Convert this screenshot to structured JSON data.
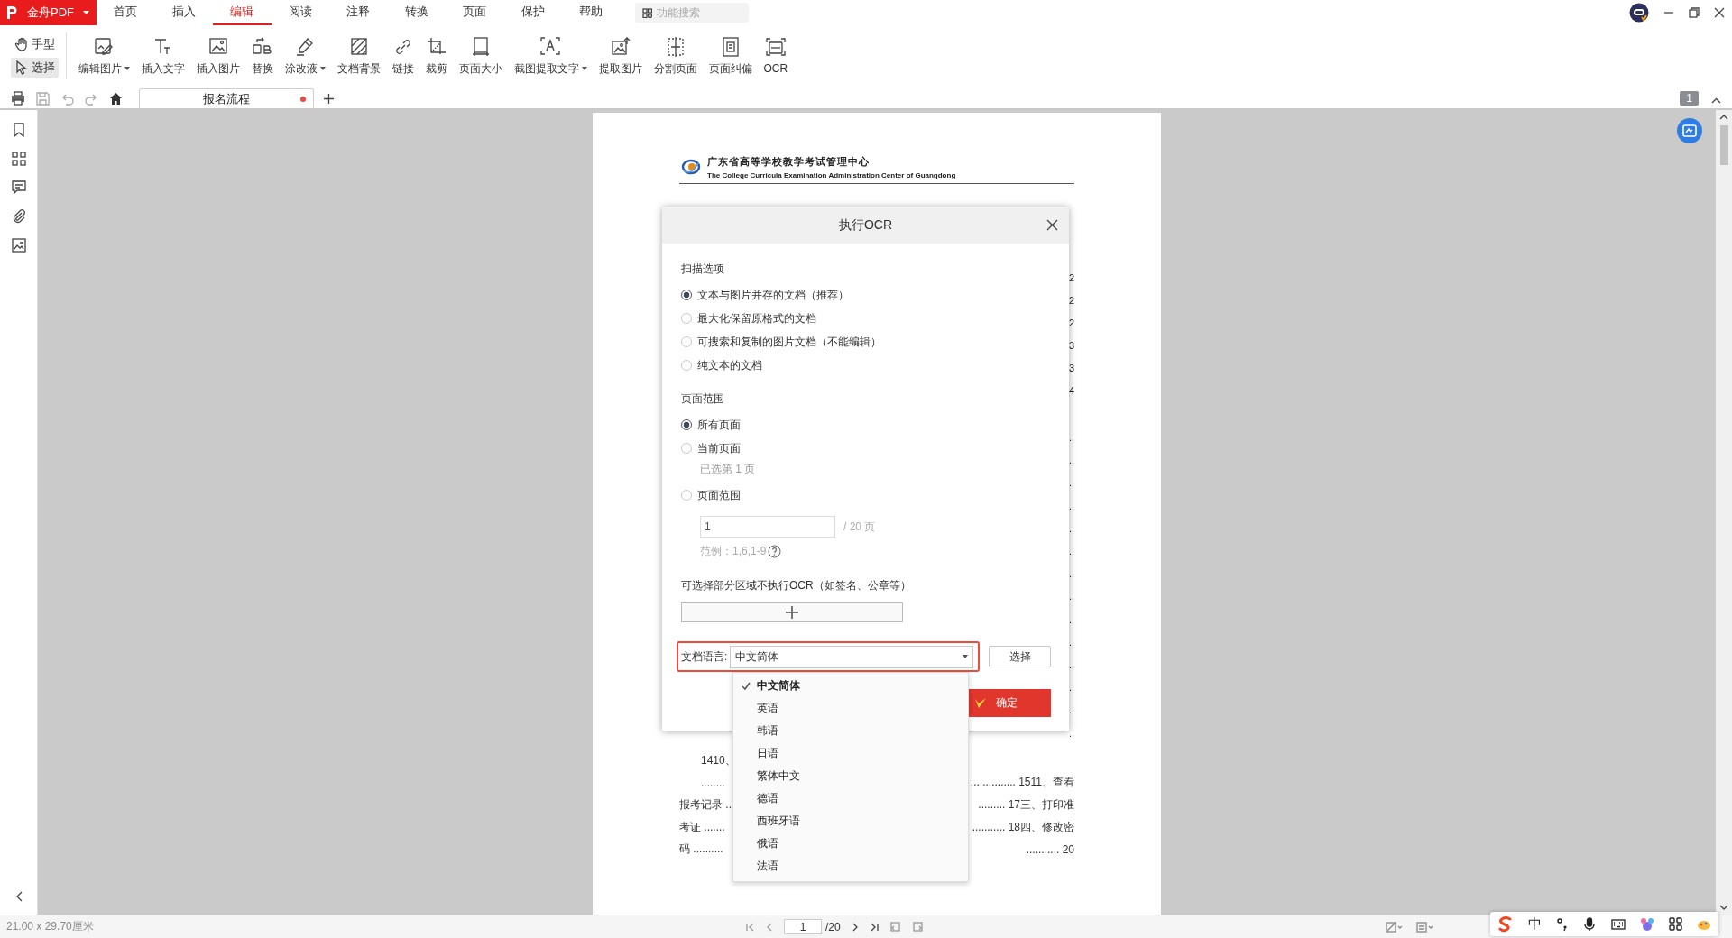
{
  "app": {
    "name": "金舟PDF"
  },
  "menu": [
    {
      "label": "首页",
      "selected": false
    },
    {
      "label": "插入",
      "selected": false
    },
    {
      "label": "编辑",
      "selected": true
    },
    {
      "label": "阅读",
      "selected": false
    },
    {
      "label": "注释",
      "selected": false
    },
    {
      "label": "转换",
      "selected": false
    },
    {
      "label": "页面",
      "selected": false
    },
    {
      "label": "保护",
      "selected": false
    },
    {
      "label": "帮助",
      "selected": false
    }
  ],
  "search": {
    "placeholder": "功能搜索"
  },
  "modes": [
    {
      "label": "手型",
      "kind": "hand",
      "selected": false
    },
    {
      "label": "选择",
      "kind": "select",
      "selected": true
    }
  ],
  "tools": [
    {
      "label": "编辑图片",
      "kind": "edit-image",
      "has_menu": true
    },
    {
      "label": "插入文字",
      "kind": "text",
      "has_menu": false
    },
    {
      "label": "插入图片",
      "kind": "image",
      "has_menu": false
    },
    {
      "label": "替换",
      "kind": "replace",
      "has_menu": false
    },
    {
      "label": "涂改液",
      "kind": "eraser",
      "has_menu": true
    },
    {
      "label": "文档背景",
      "kind": "background",
      "has_menu": false
    },
    {
      "label": "链接",
      "kind": "link",
      "has_menu": false
    },
    {
      "label": "裁剪",
      "kind": "crop",
      "has_menu": false
    },
    {
      "label": "页面大小",
      "kind": "page-size",
      "has_menu": false
    },
    {
      "label": "截图提取文字",
      "kind": "capture-text",
      "has_menu": true
    },
    {
      "label": "提取图片",
      "kind": "extract-image",
      "has_menu": false
    },
    {
      "label": "分割页面",
      "kind": "split",
      "has_menu": false
    },
    {
      "label": "页面纠偏",
      "kind": "deskew",
      "has_menu": false
    },
    {
      "label": "OCR",
      "kind": "ocr",
      "has_menu": false
    }
  ],
  "tabs": [
    {
      "label": "报名流程",
      "selected": true,
      "unsaved": true
    }
  ],
  "page_badge": "1",
  "document": {
    "header_title": "广东省高等学校教学考试管理中心",
    "header_subtitle": "The College Curricula Examination Administration Center of Guangdong",
    "edge_numbers": [
      "2",
      "2",
      "2",
      "3",
      "3",
      "4"
    ],
    "edge_dots": [
      "..",
      "..",
      "..",
      "..",
      "..",
      "..",
      "..",
      "..",
      "..",
      "..",
      "..",
      "..",
      "..",
      ".."
    ],
    "toc_rows": [
      {
        "left": "1410、",
        "indented": true
      },
      {
        "left": "........",
        "right": "............... 1511、查看",
        "indented": true
      },
      {
        "left": "报考记录 ..",
        "right": "......... 17三、打印准",
        "indented": false
      },
      {
        "left": "考证 .......",
        "right": "........... 18四、修改密",
        "indented": false
      },
      {
        "left": "码 ..........",
        "right": "........... 20",
        "indented": false
      }
    ]
  },
  "ocr_dialog": {
    "title": "执行OCR",
    "scan_label": "扫描选项",
    "scan_options": [
      {
        "label": "文本与图片并存的文档（推荐）",
        "selected": true
      },
      {
        "label": "最大化保留原格式的文档",
        "selected": false
      },
      {
        "label": "可搜索和复制的图片文档（不能编辑）",
        "selected": false
      },
      {
        "label": "纯文本的文档",
        "selected": false
      }
    ],
    "range_label": "页面范围",
    "range_options": [
      {
        "label": "所有页面",
        "selected": true
      },
      {
        "label": "当前页面",
        "selected": false,
        "note": "已选第 1 页"
      },
      {
        "label": "页面范围",
        "selected": false
      }
    ],
    "range_input": {
      "value": "1",
      "total": "/ 20 页",
      "example": "范例：1,6,1-9"
    },
    "exclude_label": "可选择部分区域不执行OCR（如签名、公章等）",
    "language_label": "文档语言:",
    "language_value": "中文简体",
    "choose_button": "选择",
    "confirm_button": "确定",
    "languages": [
      {
        "label": "中文简体",
        "selected": true
      },
      {
        "label": "英语",
        "selected": false
      },
      {
        "label": "韩语",
        "selected": false
      },
      {
        "label": "日语",
        "selected": false
      },
      {
        "label": "繁体中文",
        "selected": false
      },
      {
        "label": "德语",
        "selected": false
      },
      {
        "label": "西班牙语",
        "selected": false
      },
      {
        "label": "俄语",
        "selected": false
      },
      {
        "label": "法语",
        "selected": false
      }
    ]
  },
  "status_bar": {
    "page_size": "21.00 x 29.70厘米",
    "page_input": "1",
    "page_total": "/20"
  },
  "ime": {
    "mode": "中"
  }
}
